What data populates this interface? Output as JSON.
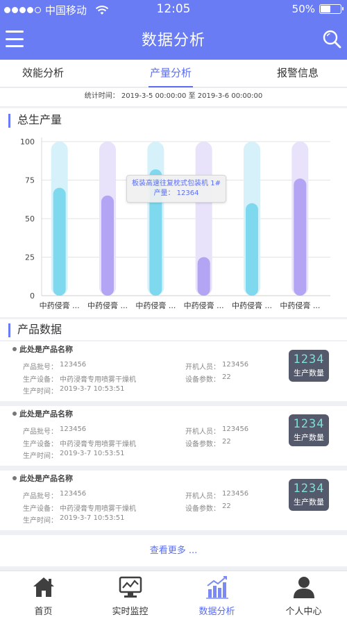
{
  "status_bar": {
    "carrier": "中国移动",
    "time": "12:05",
    "battery": "50%",
    "battery_level": 0.5
  },
  "header": {
    "title": "数据分析",
    "menu_icon": "menu-icon",
    "search_icon": "search-icon"
  },
  "tabs": [
    {
      "label": "效能分析",
      "active": false
    },
    {
      "label": "产量分析",
      "active": true
    },
    {
      "label": "报警信息",
      "active": false
    }
  ],
  "stat_time": "统计时间： 2019-3-5 00:00:00 至 2019-3-6 00:00:00",
  "chart_section": {
    "title": "总生产量"
  },
  "chart_data": {
    "type": "bar",
    "categories": [
      "中药侵膏 ...",
      "中药侵膏 ...",
      "中药侵膏 ...",
      "中药侵膏 ...",
      "中药侵膏 ...",
      "中药侵膏 ..."
    ],
    "values": [
      70,
      65,
      82,
      25,
      60,
      76
    ],
    "yticks": [
      0,
      25,
      50,
      75,
      100
    ],
    "ylim": [
      0,
      100
    ],
    "colors": [
      "#7fd9ee",
      "#b3a5f3",
      "#7fd9ee",
      "#b3a5f3",
      "#7fd9ee",
      "#b3a5f3"
    ],
    "track_colors": [
      "#d6f1fa",
      "#e8e2fa",
      "#d6f1fa",
      "#e8e2fa",
      "#d6f1fa",
      "#e8e2fa"
    ],
    "grid": true,
    "tooltip": {
      "name": "板装高速往复枕式包装机 1#",
      "value_line": "产量： 12364"
    }
  },
  "product_section": {
    "title": "产品数据",
    "labels": {
      "batch": "产品批号：",
      "device": "生产设备：",
      "time": "生产时间：",
      "operator": "开机人员：",
      "params": "设备参数："
    },
    "items": [
      {
        "name": "此处是产品名称",
        "batch": "123456",
        "device": "中药浸膏专用喷雾干燥机",
        "time": "2019-3-7 10:53:51",
        "operator": "123456",
        "params": "22",
        "qty_num": "1234",
        "qty_label": "生产数量"
      },
      {
        "name": "此处是产品名称",
        "batch": "123456",
        "device": "中药浸膏专用喷雾干燥机",
        "time": "2019-3-7 10:53:51",
        "operator": "123456",
        "params": "22",
        "qty_num": "1234",
        "qty_label": "生产数量"
      },
      {
        "name": "此处是产品名称",
        "batch": "123456",
        "device": "中药浸膏专用喷雾干燥机",
        "time": "2019-3-7 10:53:51",
        "operator": "123456",
        "params": "22",
        "qty_num": "1234",
        "qty_label": "生产数量"
      }
    ],
    "more": "查看更多 ..."
  },
  "bottom_nav": [
    {
      "label": "首页",
      "icon": "home-icon",
      "active": false
    },
    {
      "label": "实时监控",
      "icon": "monitor-icon",
      "active": false
    },
    {
      "label": "数据分析",
      "icon": "analytics-icon",
      "active": true
    },
    {
      "label": "个人中心",
      "icon": "user-icon",
      "active": false
    }
  ],
  "colors": {
    "accent": "#6a7cf3",
    "active_text": "#5b6ef0"
  }
}
